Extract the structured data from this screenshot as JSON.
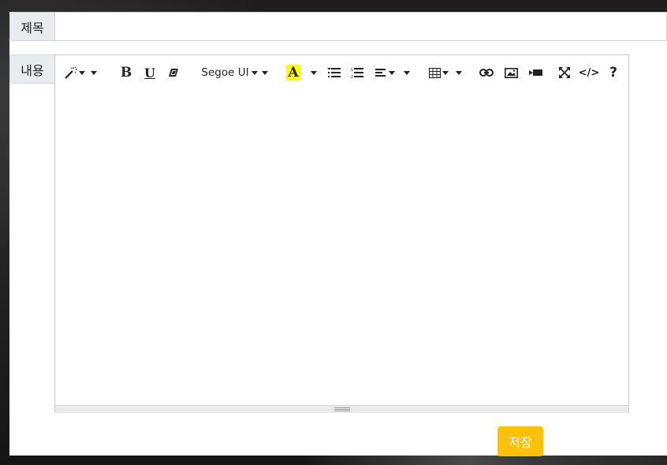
{
  "form": {
    "title_label": "제목",
    "title_value": "",
    "content_label": "내용",
    "save_label": "저장"
  },
  "toolbar": {
    "font_name": "Segoe UI",
    "bold": "B",
    "underline": "U",
    "help": "?",
    "code_view": "</>"
  },
  "colors": {
    "save_button": "#ffc107",
    "highlight": "#ffff00"
  },
  "icons": [
    "magic-wand-icon",
    "bold-icon",
    "underline-icon",
    "eraser-icon",
    "font-color-icon",
    "unordered-list-icon",
    "ordered-list-icon",
    "align-icon",
    "table-icon",
    "link-icon",
    "picture-icon",
    "video-icon",
    "fullscreen-icon",
    "code-view-icon",
    "help-icon"
  ]
}
